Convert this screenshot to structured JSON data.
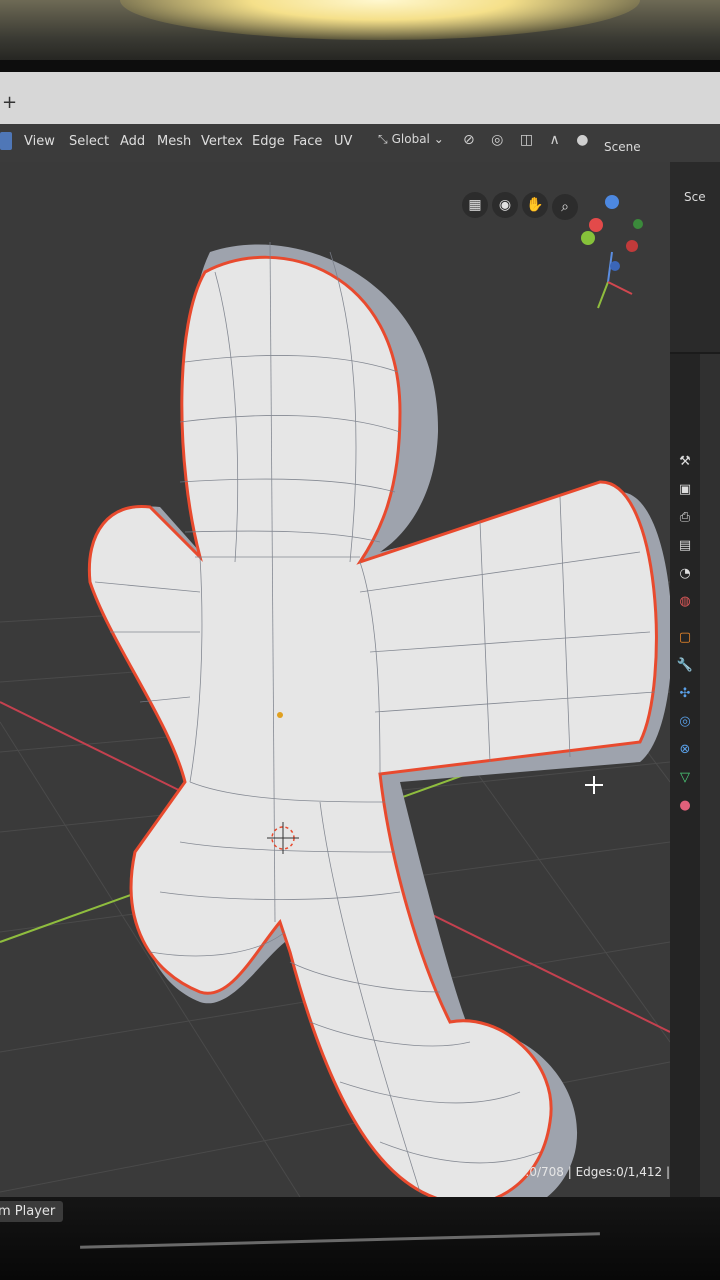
{
  "menu": {
    "items": [
      "View",
      "Select",
      "Add",
      "Mesh",
      "Vertex",
      "Edge",
      "Face",
      "UV"
    ]
  },
  "header": {
    "orientation": "Global",
    "scene": "Scene"
  },
  "outliner": {
    "scene_label": "Sce"
  },
  "status_bar": {
    "text": "Plane | Verts:0/708 | Edges:0/1,412 |"
  },
  "taskbar": {
    "item_label": "m Player"
  },
  "icons": {
    "mode": "editmode-icon",
    "orientation": "orientation-icon",
    "grid": "grid-icon",
    "camera": "camera-icon",
    "hand": "hand-pan-icon",
    "zoom": "zoom-icon"
  },
  "colors": {
    "selection_outline": "#e84a2e",
    "mesh_fill": "#e6e6e6",
    "x_axis": "#c4414f",
    "y_axis": "#8fbd3e",
    "viewport_bg": "#3a3a3a"
  }
}
